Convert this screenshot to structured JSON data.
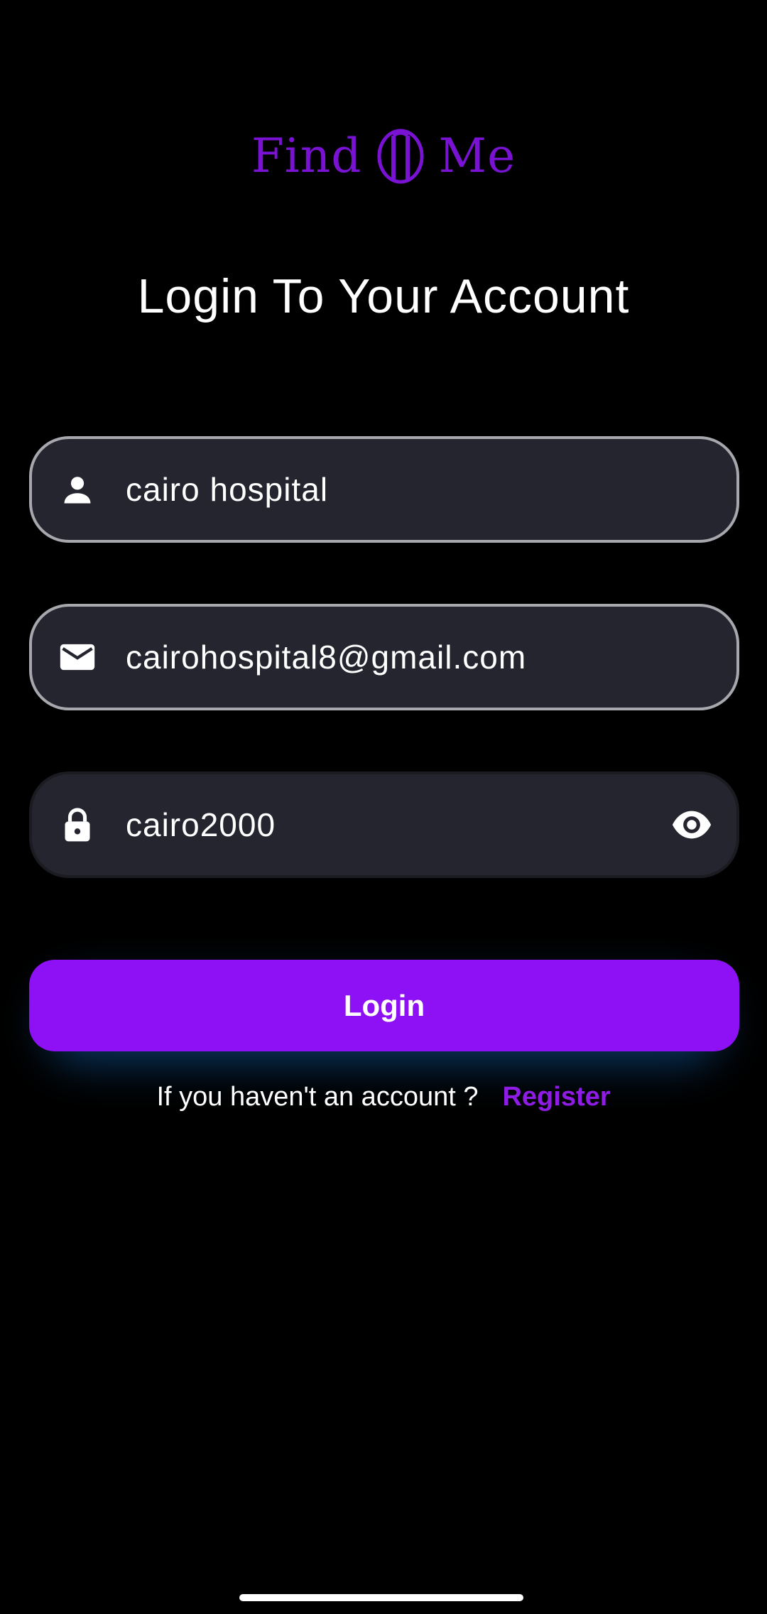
{
  "app": {
    "logo_text_left": "Find",
    "logo_text_right": "Me",
    "brand_color": "#7a12d4"
  },
  "page": {
    "title": "Login To Your Account"
  },
  "form": {
    "username": {
      "icon": "person-icon",
      "value": "cairo hospital"
    },
    "email": {
      "icon": "mail-icon",
      "value": "cairohospital8@gmail.com"
    },
    "password": {
      "icon": "lock-icon",
      "value": "cairo2000",
      "toggle_icon": "eye-icon"
    },
    "login_button_label": "Login",
    "accent_color": "#8e10f5"
  },
  "register": {
    "prompt": "If you haven't an account ?",
    "link_label": "Register"
  }
}
